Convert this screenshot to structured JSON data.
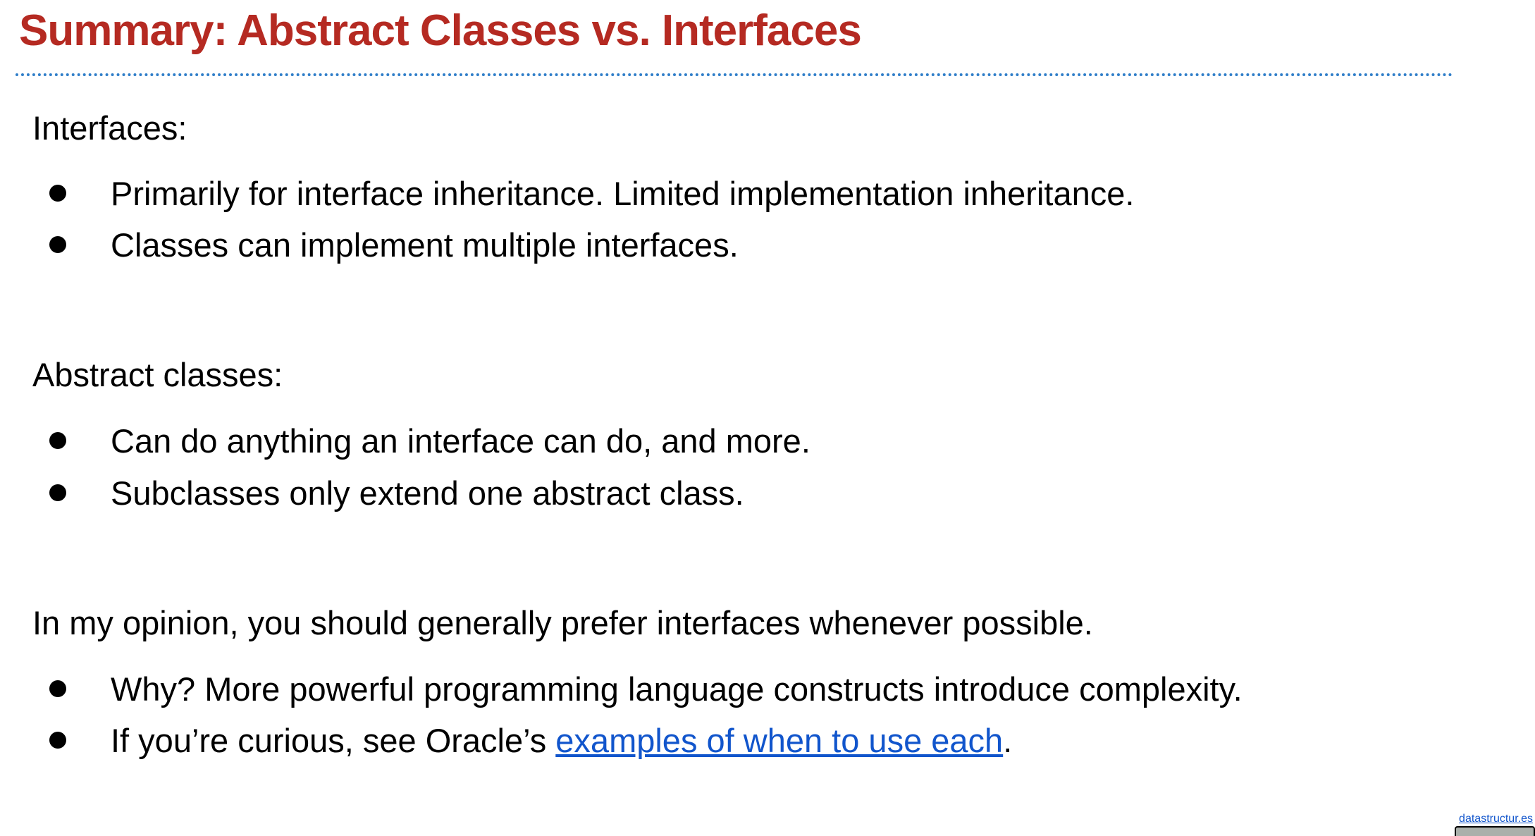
{
  "title": "Summary: Abstract Classes vs. Interfaces",
  "sections": [
    {
      "heading": "Interfaces:",
      "bullets": [
        "Primarily for interface inheritance. Limited implementation inheritance.",
        "Classes can implement multiple interfaces."
      ]
    },
    {
      "heading": "Abstract classes:",
      "bullets": [
        "Can do anything an interface can do, and more.",
        "Subclasses only extend one abstract class."
      ]
    },
    {
      "heading": "In my opinion, you should generally prefer interfaces whenever possible.",
      "bullets": [
        "Why? More powerful programming language constructs introduce complexity."
      ]
    }
  ],
  "last_bullet": {
    "prefix": "If you’re curious, see Oracle’s ",
    "link": "examples of when to use each",
    "suffix": "."
  },
  "footer_link": "datastructur.es",
  "colors": {
    "title": "#b52a22",
    "link": "#1155cc",
    "rule": "#2f7ec9"
  }
}
